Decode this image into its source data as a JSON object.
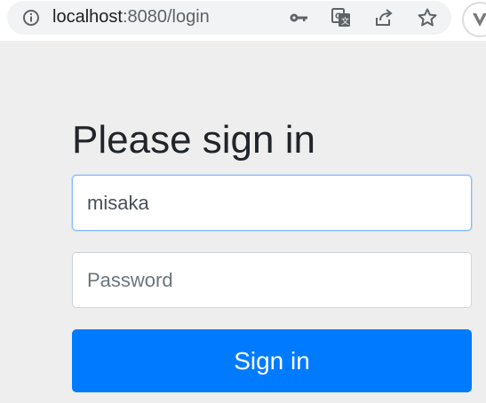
{
  "browser": {
    "url_host": "localhost",
    "url_path": ":8080/login",
    "icons": [
      "info-icon",
      "key-icon",
      "translate-icon",
      "share-icon",
      "star-icon",
      "extension-icon"
    ]
  },
  "login": {
    "heading": "Please sign in",
    "username_value": "misaka",
    "password_placeholder": "Password",
    "submit_label": "Sign in"
  },
  "colors": {
    "page_background": "#eeeeee",
    "button_primary": "#007bff",
    "heading_text": "#212529"
  }
}
